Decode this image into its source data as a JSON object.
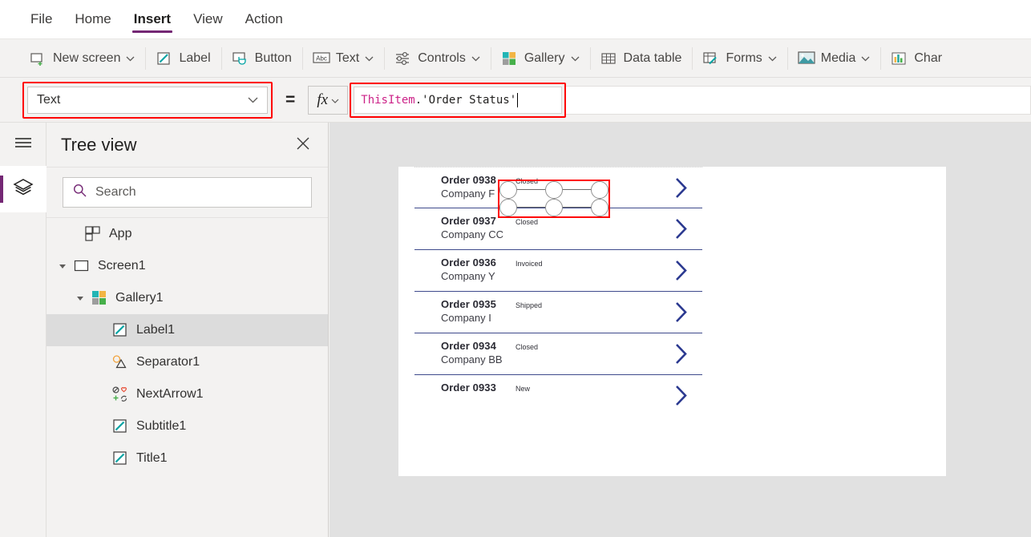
{
  "menubar": {
    "items": [
      {
        "label": "File",
        "active": false
      },
      {
        "label": "Home",
        "active": false
      },
      {
        "label": "Insert",
        "active": true
      },
      {
        "label": "View",
        "active": false
      },
      {
        "label": "Action",
        "active": false
      }
    ]
  },
  "ribbon": {
    "items": [
      {
        "label": "New screen",
        "icon": "new-screen-icon",
        "caret": true
      },
      {
        "label": "Label",
        "icon": "label-icon",
        "caret": false
      },
      {
        "label": "Button",
        "icon": "button-icon",
        "caret": false
      },
      {
        "label": "Text",
        "icon": "text-abc-icon",
        "caret": true
      },
      {
        "label": "Controls",
        "icon": "controls-sliders-icon",
        "caret": true
      },
      {
        "label": "Gallery",
        "icon": "gallery-grid-icon",
        "caret": true
      },
      {
        "label": "Data table",
        "icon": "data-table-icon",
        "caret": false
      },
      {
        "label": "Forms",
        "icon": "forms-icon",
        "caret": true
      },
      {
        "label": "Media",
        "icon": "media-image-icon",
        "caret": true
      },
      {
        "label": "Char",
        "icon": "charts-icon",
        "caret": false
      }
    ]
  },
  "formula_bar": {
    "property_value": "Text",
    "equals": "=",
    "fx_label": "fx",
    "formula_tokens": [
      {
        "text": "ThisItem",
        "type": "object"
      },
      {
        "text": ".",
        "type": "plain"
      },
      {
        "text": "'Order Status'",
        "type": "string"
      }
    ],
    "formula_full": "ThisItem.'Order Status'",
    "highlight_color": "#ff0000"
  },
  "left_rail": {
    "menu_icon": "hamburger-menu-icon",
    "tree_view_icon": "layers-icon",
    "accent_color": "#742774"
  },
  "tree_view": {
    "title": "Tree view",
    "close_icon": "close-icon",
    "search": {
      "placeholder": "Search",
      "icon": "search-icon"
    },
    "nodes": [
      {
        "label": "App",
        "icon": "app-icon",
        "indent": 0,
        "twisty": "none",
        "selected": false
      },
      {
        "label": "Screen1",
        "icon": "screen-icon",
        "indent": 0,
        "twisty": "expanded",
        "selected": false
      },
      {
        "label": "Gallery1",
        "icon": "gallery-icon",
        "indent": 1,
        "twisty": "expanded",
        "selected": false
      },
      {
        "label": "Label1",
        "icon": "label-icon",
        "indent": 2,
        "twisty": "none",
        "selected": true
      },
      {
        "label": "Separator1",
        "icon": "separator-icon",
        "indent": 2,
        "twisty": "none",
        "selected": false
      },
      {
        "label": "NextArrow1",
        "icon": "next-arrow-icon",
        "indent": 2,
        "twisty": "none",
        "selected": false
      },
      {
        "label": "Subtitle1",
        "icon": "label-icon",
        "indent": 2,
        "twisty": "none",
        "selected": false
      },
      {
        "label": "Title1",
        "icon": "label-icon",
        "indent": 2,
        "twisty": "none",
        "selected": false
      }
    ]
  },
  "canvas": {
    "background_color": "#e1e1e1",
    "screen_color": "#ffffff",
    "chevron_color": "#2B3990",
    "gallery": {
      "rows": [
        {
          "title": "Order 0938",
          "subtitle": "Company F",
          "status": "Closed",
          "selected": true
        },
        {
          "title": "Order 0937",
          "subtitle": "Company CC",
          "status": "Closed",
          "selected": false
        },
        {
          "title": "Order 0936",
          "subtitle": "Company Y",
          "status": "Invoiced",
          "selected": false
        },
        {
          "title": "Order 0935",
          "subtitle": "Company I",
          "status": "Shipped",
          "selected": false
        },
        {
          "title": "Order 0934",
          "subtitle": "Company BB",
          "status": "Closed",
          "selected": false
        },
        {
          "title": "Order 0933",
          "subtitle": "",
          "status": "New",
          "selected": false
        }
      ]
    }
  }
}
